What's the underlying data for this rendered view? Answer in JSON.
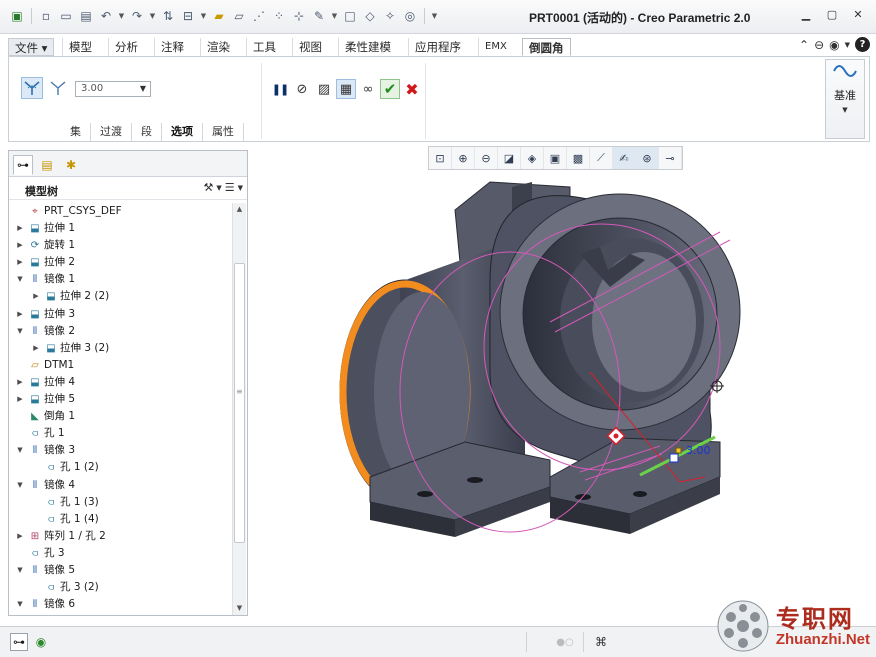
{
  "title": "PRT0001 (活动的) - Creo Parametric 2.0",
  "ribbon_tabs": [
    "文件",
    "模型",
    "分析",
    "注释",
    "渲染",
    "工具",
    "视图",
    "柔性建模",
    "应用程序",
    "EMX",
    "倒圆角"
  ],
  "ribbon": {
    "value": "3.00",
    "subtabs": [
      "集",
      "过渡",
      "段",
      "选项",
      "属性"
    ],
    "datum_label": "基准"
  },
  "model_tree": {
    "title": "模型树",
    "items": [
      {
        "label": "PRT_CSYS_DEF",
        "level": 0,
        "toggle": "",
        "icon": "csys-icon"
      },
      {
        "label": "拉伸 1",
        "level": 0,
        "toggle": "▶",
        "icon": "extrude-icon"
      },
      {
        "label": "旋转 1",
        "level": 0,
        "toggle": "▶",
        "icon": "revolve-icon"
      },
      {
        "label": "拉伸 2",
        "level": 0,
        "toggle": "▶",
        "icon": "extrude-icon"
      },
      {
        "label": "镜像 1",
        "level": 0,
        "toggle": "▼",
        "icon": "mirror-icon"
      },
      {
        "label": "拉伸 2 (2)",
        "level": 1,
        "toggle": "▶",
        "icon": "extrude-icon"
      },
      {
        "label": "拉伸 3",
        "level": 0,
        "toggle": "▶",
        "icon": "extrude-icon"
      },
      {
        "label": "镜像 2",
        "level": 0,
        "toggle": "▼",
        "icon": "mirror-icon"
      },
      {
        "label": "拉伸 3 (2)",
        "level": 1,
        "toggle": "▶",
        "icon": "extrude-icon"
      },
      {
        "label": "DTM1",
        "level": 0,
        "toggle": "",
        "icon": "datum-plane-icon"
      },
      {
        "label": "拉伸 4",
        "level": 0,
        "toggle": "▶",
        "icon": "extrude-icon"
      },
      {
        "label": "拉伸 5",
        "level": 0,
        "toggle": "▶",
        "icon": "extrude-icon"
      },
      {
        "label": "倒角 1",
        "level": 0,
        "toggle": "",
        "icon": "chamfer-icon"
      },
      {
        "label": "孔 1",
        "level": 0,
        "toggle": "",
        "icon": "hole-icon"
      },
      {
        "label": "镜像 3",
        "level": 0,
        "toggle": "▼",
        "icon": "mirror-icon"
      },
      {
        "label": "孔 1 (2)",
        "level": 1,
        "toggle": "",
        "icon": "hole-icon"
      },
      {
        "label": "镜像 4",
        "level": 0,
        "toggle": "▼",
        "icon": "mirror-icon"
      },
      {
        "label": "孔 1 (3)",
        "level": 1,
        "toggle": "",
        "icon": "hole-icon"
      },
      {
        "label": "孔 1 (4)",
        "level": 1,
        "toggle": "",
        "icon": "hole-icon"
      },
      {
        "label": "阵列 1 / 孔 2",
        "level": 0,
        "toggle": "▶",
        "icon": "pattern-icon"
      },
      {
        "label": "孔 3",
        "level": 0,
        "toggle": "",
        "icon": "hole-icon"
      },
      {
        "label": "镜像 5",
        "level": 0,
        "toggle": "▼",
        "icon": "mirror-icon"
      },
      {
        "label": "孔 3 (2)",
        "level": 1,
        "toggle": "",
        "icon": "hole-icon"
      },
      {
        "label": "镜像 6",
        "level": 0,
        "toggle": "▼",
        "icon": "mirror-icon"
      }
    ]
  },
  "graphics": {
    "dimension_value": "3.00"
  },
  "watermark": {
    "cn": "专职网",
    "en": "Zhuanzhi.Net"
  }
}
